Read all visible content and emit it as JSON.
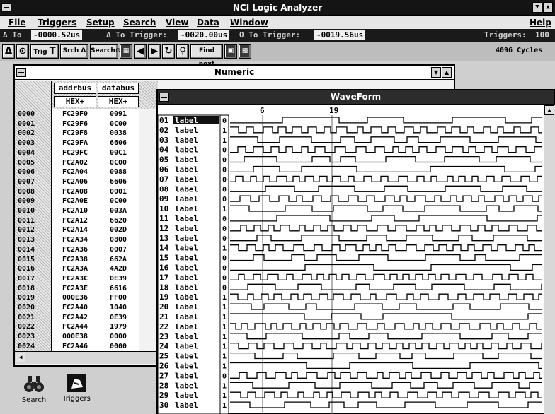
{
  "app": {
    "title": "NCI Logic Analyzer"
  },
  "menu": [
    "File",
    "Triggers",
    "Setup",
    "Search",
    "View",
    "Data",
    "Window",
    "Help"
  ],
  "status": {
    "a_label": "Δ To ",
    "a_value": "-0000.52us",
    "b_label": "Δ To Trigger:",
    "b_value": "-0020.00us",
    "c_label": "O To Trigger:",
    "c_value": "-0019.56us",
    "trigger_label": "Triggers:",
    "trigger_value": "100",
    "cycles": "4096 Cycles"
  },
  "toolbar": {
    "trig_label": "Trig",
    "srch_label": "Srch",
    "search_label": "Search",
    "find_label": "Find next"
  },
  "numeric": {
    "title": "Numeric",
    "col_addr": "addrbus",
    "col_data": "databus",
    "fmt_addr": "HEX+",
    "fmt_data": "HEX+",
    "rows": [
      {
        "n": "0000",
        "addr": "FC29F0",
        "data": "0091"
      },
      {
        "n": "0001",
        "addr": "FC29F6",
        "data": "0C00"
      },
      {
        "n": "0002",
        "addr": "FC29F8",
        "data": "0038"
      },
      {
        "n": "0003",
        "addr": "FC29FA",
        "data": "6606"
      },
      {
        "n": "0004",
        "addr": "FC29FC",
        "data": "00C1"
      },
      {
        "n": "0005",
        "addr": "FC2A02",
        "data": "0C00"
      },
      {
        "n": "0006",
        "addr": "FC2A04",
        "data": "0088"
      },
      {
        "n": "0007",
        "addr": "FC2A06",
        "data": "6606"
      },
      {
        "n": "0008",
        "addr": "FC2A08",
        "data": "0001"
      },
      {
        "n": "0009",
        "addr": "FC2A0E",
        "data": "0C00"
      },
      {
        "n": "0010",
        "addr": "FC2A10",
        "data": "003A"
      },
      {
        "n": "0011",
        "addr": "FC2A12",
        "data": "6620"
      },
      {
        "n": "0012",
        "addr": "FC2A14",
        "data": "002D"
      },
      {
        "n": "0013",
        "addr": "FC2A34",
        "data": "0800"
      },
      {
        "n": "0014",
        "addr": "FC2A36",
        "data": "0007"
      },
      {
        "n": "0015",
        "addr": "FC2A38",
        "data": "662A"
      },
      {
        "n": "0016",
        "addr": "FC2A3A",
        "data": "4A2D"
      },
      {
        "n": "0017",
        "addr": "FC2A3C",
        "data": "0E39"
      },
      {
        "n": "0018",
        "addr": "FC2A3E",
        "data": "6616"
      },
      {
        "n": "0019",
        "addr": "000E36",
        "data": "FF00"
      },
      {
        "n": "0020",
        "addr": "FC2A40",
        "data": "1040"
      },
      {
        "n": "0021",
        "addr": "FC2A42",
        "data": "0E39"
      },
      {
        "n": "0022",
        "addr": "FC2A44",
        "data": "1979"
      },
      {
        "n": "0023",
        "addr": "000E38",
        "data": "0000"
      },
      {
        "n": "0024",
        "addr": "FC2A46",
        "data": "0000"
      }
    ]
  },
  "waveform": {
    "title": "WaveForm",
    "markers": [
      {
        "label": "6"
      },
      {
        "label": "19"
      }
    ],
    "rows": [
      {
        "n": "01",
        "label": "label",
        "val": "0"
      },
      {
        "n": "02",
        "label": "label",
        "val": "1"
      },
      {
        "n": "03",
        "label": "label",
        "val": "1"
      },
      {
        "n": "04",
        "label": "label",
        "val": "0"
      },
      {
        "n": "05",
        "label": "label",
        "val": "0"
      },
      {
        "n": "06",
        "label": "label",
        "val": "0"
      },
      {
        "n": "07",
        "label": "label",
        "val": "0"
      },
      {
        "n": "08",
        "label": "label",
        "val": "0"
      },
      {
        "n": "09",
        "label": "label",
        "val": "0"
      },
      {
        "n": "10",
        "label": "label",
        "val": "1"
      },
      {
        "n": "11",
        "label": "label",
        "val": "0"
      },
      {
        "n": "12",
        "label": "label",
        "val": "0"
      },
      {
        "n": "13",
        "label": "label",
        "val": "0"
      },
      {
        "n": "14",
        "label": "label",
        "val": "1"
      },
      {
        "n": "15",
        "label": "label",
        "val": "0"
      },
      {
        "n": "16",
        "label": "label",
        "val": "0"
      },
      {
        "n": "17",
        "label": "label",
        "val": "0"
      },
      {
        "n": "18",
        "label": "label",
        "val": "0"
      },
      {
        "n": "19",
        "label": "label",
        "val": "1"
      },
      {
        "n": "20",
        "label": "label",
        "val": "1"
      },
      {
        "n": "21",
        "label": "label",
        "val": "1"
      },
      {
        "n": "22",
        "label": "label",
        "val": "1"
      },
      {
        "n": "23",
        "label": "label",
        "val": "1"
      },
      {
        "n": "24",
        "label": "label",
        "val": "1"
      },
      {
        "n": "25",
        "label": "label",
        "val": "1"
      },
      {
        "n": "26",
        "label": "label",
        "val": "1"
      },
      {
        "n": "27",
        "label": "label",
        "val": "0"
      },
      {
        "n": "28",
        "label": "label",
        "val": "1"
      },
      {
        "n": "29",
        "label": "label",
        "val": "1"
      },
      {
        "n": "30",
        "label": "label",
        "val": "1"
      }
    ]
  },
  "desktop_icons": [
    {
      "label": "Search",
      "icon": "binoculars-icon"
    },
    {
      "label": "Triggers",
      "icon": "triggers-icon"
    }
  ]
}
